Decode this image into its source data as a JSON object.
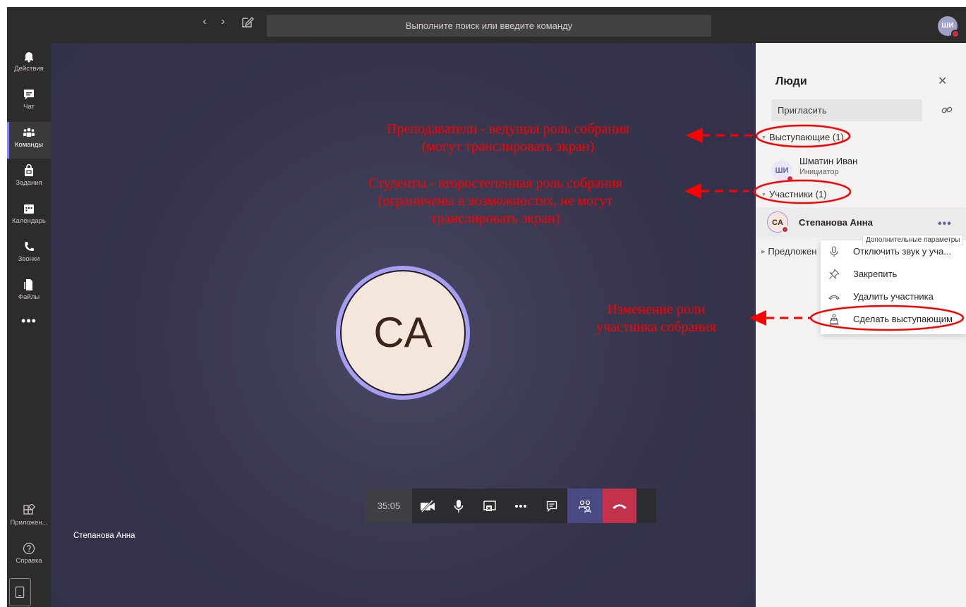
{
  "topbar": {
    "back_glyph": "‹",
    "forward_glyph": "›",
    "compose_icon": "compose-icon",
    "search_placeholder": "Выполните поиск или введите команду",
    "user_initials": "ШИ"
  },
  "rail": {
    "items": [
      {
        "label": "Действия",
        "icon": "bell-icon"
      },
      {
        "label": "Чат",
        "icon": "chat-icon"
      },
      {
        "label": "Команды",
        "icon": "teams-icon",
        "active": true
      },
      {
        "label": "Задания",
        "icon": "assignments-icon"
      },
      {
        "label": "Календарь",
        "icon": "calendar-icon"
      },
      {
        "label": "Звонки",
        "icon": "phone-icon"
      },
      {
        "label": "Файлы",
        "icon": "file-icon"
      }
    ],
    "more": "•••",
    "apps_label": "Приложен...",
    "help_label": "Справка"
  },
  "stage": {
    "avatar_initials": "CA",
    "participant_name": "Степанова Анна"
  },
  "callbar": {
    "timer": "35:05",
    "buttons": [
      "camera-off-icon",
      "mic-icon",
      "share-screen-icon",
      "more-icon",
      "chat-toggle-icon",
      "people-icon",
      "hangup-icon"
    ]
  },
  "panel": {
    "title": "Люди",
    "invite_placeholder": "Пригласить",
    "presenters_header": "Выступающие (1)",
    "presenter": {
      "initials": "ШИ",
      "name": "Шматин Иван",
      "role": "Инициатор"
    },
    "attendees_header": "Участники (1)",
    "attendee": {
      "initials": "CA",
      "name": "Степанова Анна"
    },
    "suggested_header": "Предложен",
    "more_tooltip": "Дополнительные параметры"
  },
  "menu": {
    "items": [
      {
        "label": "Отключить звук у уча...",
        "icon": "mic-icon"
      },
      {
        "label": "Закрепить",
        "icon": "pin-icon"
      },
      {
        "label": "Удалить участника",
        "icon": "remove-person-icon"
      },
      {
        "label": "Сделать выступающим",
        "icon": "presenter-icon"
      }
    ]
  },
  "annotations": {
    "presenters": [
      "Преподаватели - ведущая роль собрания",
      "(могут транслировать экран)"
    ],
    "attendees": [
      "Студенты - второстепенная роль собрания",
      "(ограничены в возможностях, не могут",
      "транслировать экран)"
    ],
    "role_change": [
      "Изменение роли",
      "участника собрания"
    ]
  },
  "colors": {
    "accent": "#6264a7",
    "annotation_red": "#ff0000",
    "hangup": "#c4314b",
    "stage_bg": "#35344b"
  }
}
